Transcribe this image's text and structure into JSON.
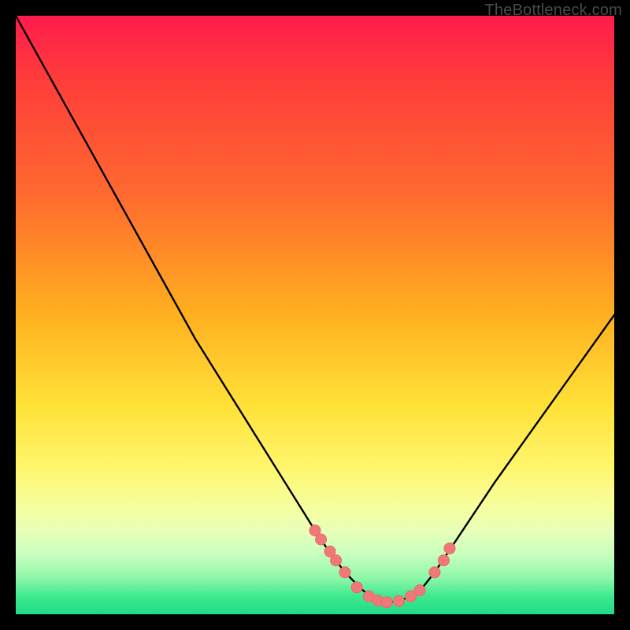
{
  "watermark": {
    "text": "TheBottleneck.com"
  },
  "colors": {
    "curve": "#000000",
    "dot_fill": "#f07878",
    "dot_stroke": "#e86a6a",
    "background_top": "#ff1b4d",
    "background_bottom": "#20db86"
  },
  "chart_data": {
    "type": "line",
    "title": "",
    "xlabel": "",
    "ylabel": "",
    "xlim": [
      0,
      100
    ],
    "ylim": [
      0,
      100
    ],
    "grid": false,
    "note": "Axes unlabeled. Values are percent of plot area from bottom-left. Curve shape: steep descending left section, flat valley minimum near x≈62, rising right section.",
    "series": [
      {
        "name": "bottleneck-curve",
        "x": [
          0,
          5,
          10,
          15,
          20,
          25,
          30,
          35,
          40,
          45,
          50,
          52,
          55,
          58,
          60,
          62,
          64,
          66,
          68,
          70,
          72,
          75,
          80,
          85,
          90,
          95,
          100
        ],
        "values": [
          100,
          91,
          82,
          73,
          64,
          55,
          46,
          38,
          30,
          22,
          14,
          11,
          7,
          4,
          2.5,
          2,
          2.2,
          3,
          4.5,
          7,
          10,
          14.5,
          22,
          29,
          36,
          43,
          50
        ]
      }
    ],
    "points": {
      "name": "highlight-dots",
      "note": "Salmon-colored dot markers overlaid on the curve near the valley and shoulders.",
      "x": [
        50,
        51,
        52.5,
        53.5,
        55,
        57,
        59,
        60.5,
        62,
        64,
        66,
        67.5,
        70,
        71.5,
        72.5
      ],
      "y": [
        14,
        12.5,
        10.5,
        9,
        7,
        4.5,
        3,
        2.3,
        2,
        2.2,
        3,
        4,
        7,
        9,
        11
      ]
    }
  }
}
